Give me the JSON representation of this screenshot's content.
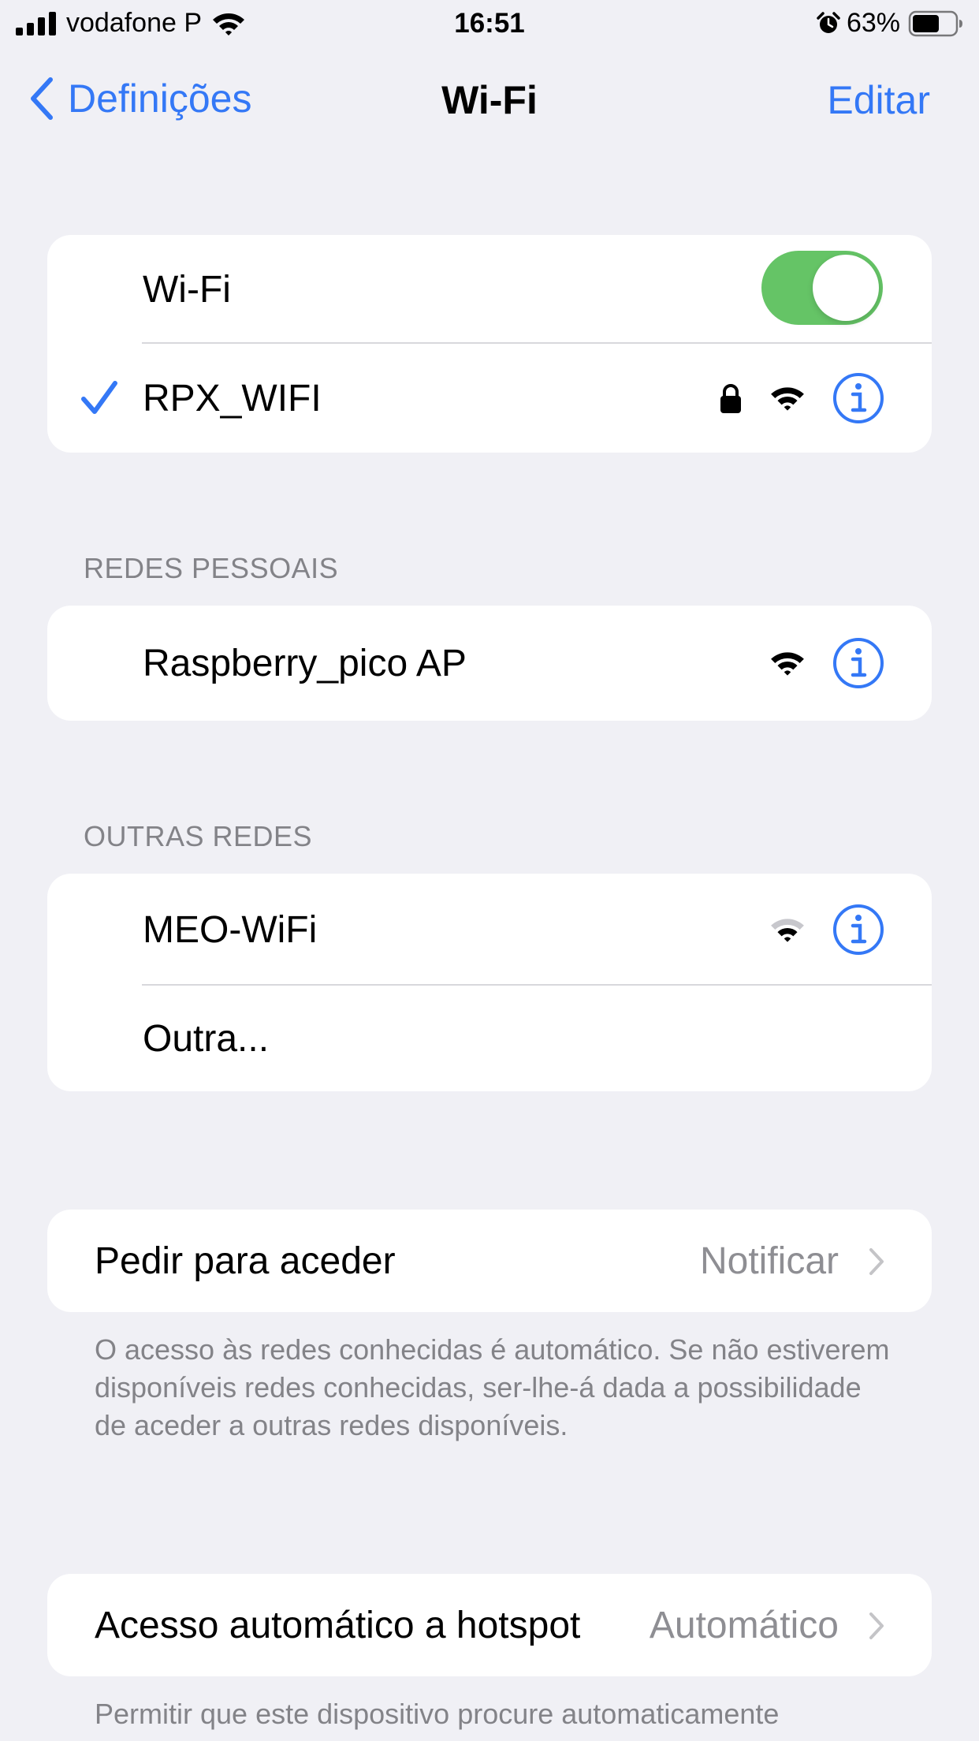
{
  "status_bar": {
    "carrier": "vodafone P",
    "time": "16:51",
    "battery_percent": "63%",
    "battery_level": 0.63,
    "signal_icon": "cellular-signal-icon",
    "wifi_icon": "wifi-icon",
    "alarm_icon": "alarm-icon"
  },
  "nav": {
    "back_label": "Definições",
    "title": "Wi-Fi",
    "edit_label": "Editar"
  },
  "wifi_group": {
    "toggle_label": "Wi-Fi",
    "toggle_on": true,
    "connected_network": "RPX_WIFI"
  },
  "personal_networks": {
    "header": "REDES PESSOAIS",
    "items": [
      {
        "name": "Raspberry_pico AP"
      }
    ]
  },
  "other_networks": {
    "header": "OUTRAS REDES",
    "items": [
      {
        "name": "MEO-WiFi"
      }
    ],
    "other_label": "Outra..."
  },
  "ask_to_join": {
    "label": "Pedir para aceder",
    "value": "Notificar",
    "footer": "O acesso às redes conhecidas é automático. Se não estiverem disponíveis redes conhecidas, ser-lhe-á dada a possibilidade de aceder a outras redes disponíveis."
  },
  "auto_hotspot": {
    "label": "Acesso automático a hotspot",
    "value": "Automático",
    "footer": "Permitir que este dispositivo procure automaticamente"
  },
  "colors": {
    "accent": "#3478f6",
    "toggle_on": "#65c466",
    "background": "#f0f0f5",
    "secondary_text": "#838388"
  }
}
